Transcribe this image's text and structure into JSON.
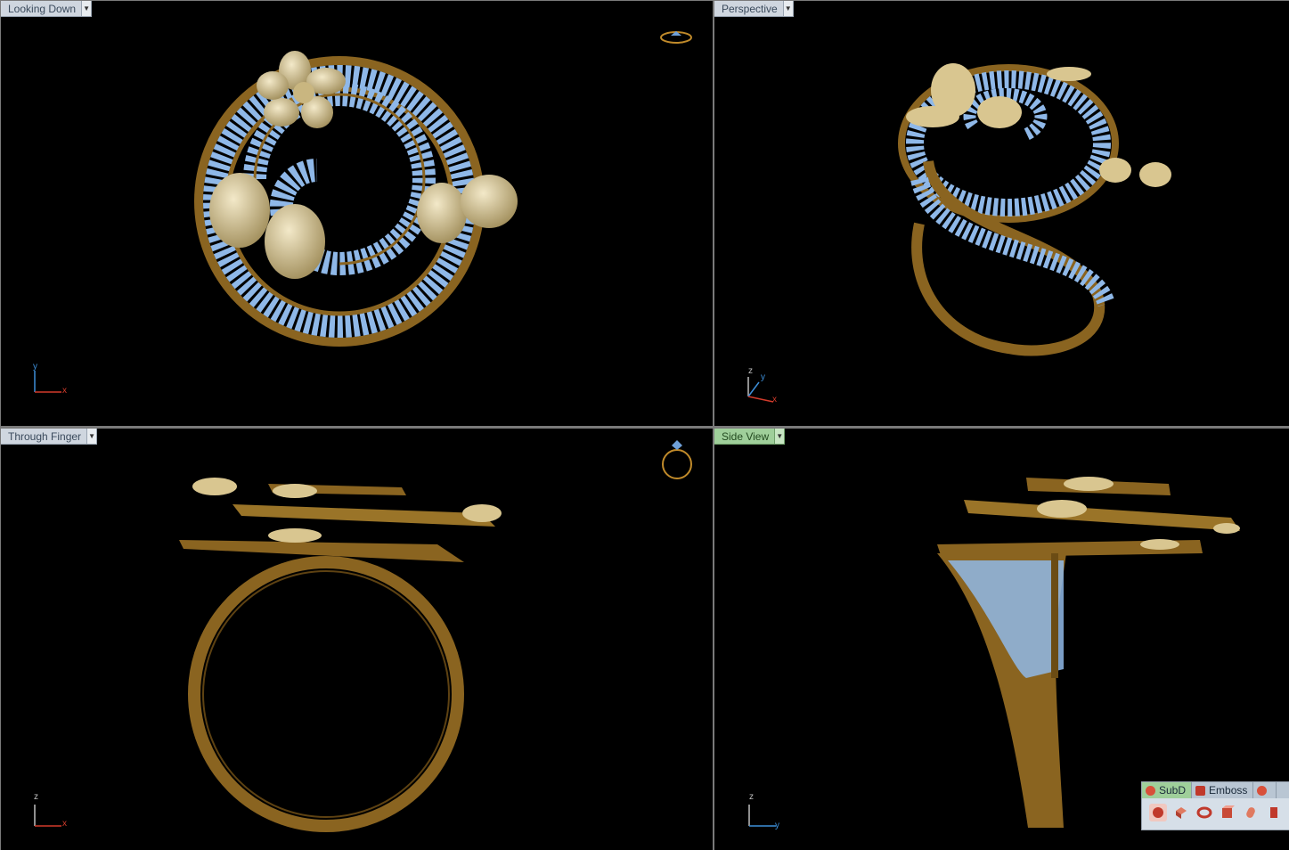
{
  "viewports": {
    "top_left": {
      "label": "Looking Down",
      "axes": {
        "vertical": "y",
        "horizontal": "x"
      }
    },
    "top_right": {
      "label": "Perspective",
      "axes": {
        "depth": "z",
        "vertical": "y",
        "horizontal": "x"
      }
    },
    "bottom_left": {
      "label": "Through Finger",
      "axes": {
        "vertical": "z",
        "horizontal": "x"
      }
    },
    "bottom_right": {
      "label": "Side View",
      "axes": {
        "vertical": "z",
        "horizontal": "y"
      },
      "active": true
    }
  },
  "toolbar": {
    "tabs": [
      {
        "label": "SubD",
        "icon": "subd-icon",
        "active": true
      },
      {
        "label": "Emboss",
        "icon": "emboss-icon",
        "active": false
      },
      {
        "label": "",
        "icon": "tab-more-icon",
        "active": false
      }
    ],
    "tools": [
      "subd-sphere-icon",
      "subd-box-icon",
      "subd-torus-icon",
      "subd-cube-icon",
      "subd-cylinder-icon",
      "subd-extra-icon"
    ]
  },
  "colors": {
    "viewport_bg": "#000000",
    "gold": "#a07a2a",
    "gold_light": "#d9c690",
    "gem_blue": "#8fb8e8",
    "active_tab": "#9fcf9a",
    "axis_x": "#d23b2b",
    "axis_y": "#3d8fd9",
    "axis_z": "#bfbfbf"
  }
}
